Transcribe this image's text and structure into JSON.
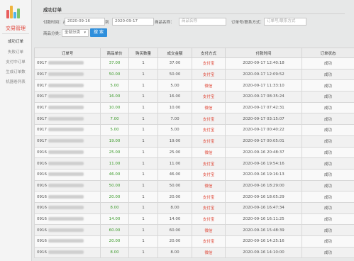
{
  "sidebar": {
    "title": "交易管理",
    "items": [
      "成功订单",
      "失败订单",
      "支付中订单",
      "生成订单数",
      "机器卷列表"
    ],
    "active_index": 0
  },
  "page": {
    "title": "成功订单"
  },
  "filters": {
    "pay_time_label": "付款时间：从",
    "date_from": "2020-09-16",
    "to_label": "到",
    "date_to": "2020-09-17",
    "product_name_label": "商品名称：",
    "product_name_placeholder": "商品名称",
    "order_no_label": "订单号/联系方式：",
    "order_no_placeholder": "订单号/联系方式",
    "category_label": "商品分类：",
    "category_value": "全部分类",
    "search_button": "搜 索"
  },
  "table": {
    "headers": [
      "订单号",
      "商品单价",
      "购买数量",
      "成交金额",
      "支付方式",
      "付款时间",
      "订单状态"
    ],
    "rows": [
      {
        "order_prefix": "0917",
        "price": "37.00",
        "qty": "1",
        "amount": "37.00",
        "pay": "支付宝",
        "time": "2020-09-17 12:40:18",
        "status": "成功"
      },
      {
        "order_prefix": "0917",
        "price": "50.00",
        "qty": "1",
        "amount": "50.00",
        "pay": "支付宝",
        "time": "2020-09-17 12:09:52",
        "status": "成功"
      },
      {
        "order_prefix": "0917",
        "price": "5.00",
        "qty": "1",
        "amount": "5.00",
        "pay": "微信",
        "time": "2020-09-17 11:33:10",
        "status": "成功"
      },
      {
        "order_prefix": "0917",
        "price": "16.00",
        "qty": "1",
        "amount": "16.00",
        "pay": "支付宝",
        "time": "2020-09-17 08:35:24",
        "status": "成功"
      },
      {
        "order_prefix": "0917",
        "price": "10.00",
        "qty": "1",
        "amount": "10.00",
        "pay": "微信",
        "time": "2020-09-17 07:42:31",
        "status": "成功"
      },
      {
        "order_prefix": "0917",
        "price": "7.00",
        "qty": "1",
        "amount": "7.00",
        "pay": "支付宝",
        "time": "2020-09-17 03:15:07",
        "status": "成功"
      },
      {
        "order_prefix": "0917",
        "price": "5.00",
        "qty": "1",
        "amount": "5.00",
        "pay": "支付宝",
        "time": "2020-09-17 00:40:22",
        "status": "成功"
      },
      {
        "order_prefix": "0917",
        "price": "19.00",
        "qty": "1",
        "amount": "19.00",
        "pay": "支付宝",
        "time": "2020-09-17 00:05:01",
        "status": "成功"
      },
      {
        "order_prefix": "0916",
        "price": "25.00",
        "qty": "1",
        "amount": "25.00",
        "pay": "微信",
        "time": "2020-09-16 20:48:37",
        "status": "成功"
      },
      {
        "order_prefix": "0916",
        "price": "11.00",
        "qty": "1",
        "amount": "11.00",
        "pay": "支付宝",
        "time": "2020-09-16 19:54:16",
        "status": "成功"
      },
      {
        "order_prefix": "0916",
        "price": "46.00",
        "qty": "1",
        "amount": "46.00",
        "pay": "支付宝",
        "time": "2020-09-16 19:16:13",
        "status": "成功"
      },
      {
        "order_prefix": "0916",
        "price": "50.00",
        "qty": "1",
        "amount": "50.00",
        "pay": "微信",
        "time": "2020-09-16 18:29:00",
        "status": "成功"
      },
      {
        "order_prefix": "0916",
        "price": "20.00",
        "qty": "1",
        "amount": "20.00",
        "pay": "支付宝",
        "time": "2020-09-16 18:05:29",
        "status": "成功"
      },
      {
        "order_prefix": "0916",
        "price": "8.00",
        "qty": "1",
        "amount": "8.00",
        "pay": "支付宝",
        "time": "2020-09-16 16:47:34",
        "status": "成功"
      },
      {
        "order_prefix": "0916",
        "price": "14.00",
        "qty": "1",
        "amount": "14.00",
        "pay": "支付宝",
        "time": "2020-09-16 16:11:25",
        "status": "成功"
      },
      {
        "order_prefix": "0916",
        "price": "60.00",
        "qty": "1",
        "amount": "60.00",
        "pay": "微信",
        "time": "2020-09-16 15:48:39",
        "status": "成功"
      },
      {
        "order_prefix": "0916",
        "price": "20.00",
        "qty": "1",
        "amount": "20.00",
        "pay": "支付宝",
        "time": "2020-09-16 14:25:16",
        "status": "成功"
      },
      {
        "order_prefix": "0916",
        "price": "8.00",
        "qty": "1",
        "amount": "8.00",
        "pay": "微信",
        "time": "2020-09-16 14:10:00",
        "status": "成功"
      }
    ]
  },
  "colors": {
    "accent": "#2f8fdc",
    "price_green": "#3d9a2c",
    "pay_red": "#e04a3a",
    "nav_active": "#e0443a"
  }
}
